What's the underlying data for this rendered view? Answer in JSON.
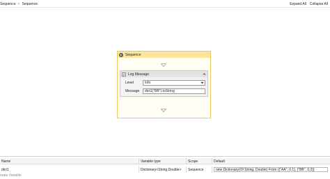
{
  "breadcrumb": {
    "items": [
      "Sequence",
      "Sequence"
    ],
    "separator": ">"
  },
  "toolbar": {
    "expand_all": "Expand All",
    "collapse_all": "Collapse All"
  },
  "sequence": {
    "title": "Sequence",
    "header_color": "#fbe49c",
    "border_color": "#f0c860"
  },
  "log_message": {
    "title": "Log Message",
    "level_label": "Level",
    "level_value": "Info",
    "message_label": "Message",
    "message_value": "dict1(\"BB\").toString"
  },
  "variables": {
    "columns": [
      "Name",
      "Variable type",
      "Scope",
      "Default"
    ],
    "rows": [
      {
        "name": "dict1",
        "type": "Dictionary<String,Double>",
        "scope": "Sequence",
        "default": "new Dictionary(Of String, Double) From {{\"AA\", 0.1}, {\"BB\", 0.2}}"
      }
    ],
    "create_label": "reate Variable"
  },
  "icons": {
    "sequence": "sequence-icon",
    "log": "log-message-icon",
    "collapse": "chevron-up-icon",
    "dropdown": "chevron-down-icon",
    "drop_target": "drop-target-arrow-icon"
  }
}
